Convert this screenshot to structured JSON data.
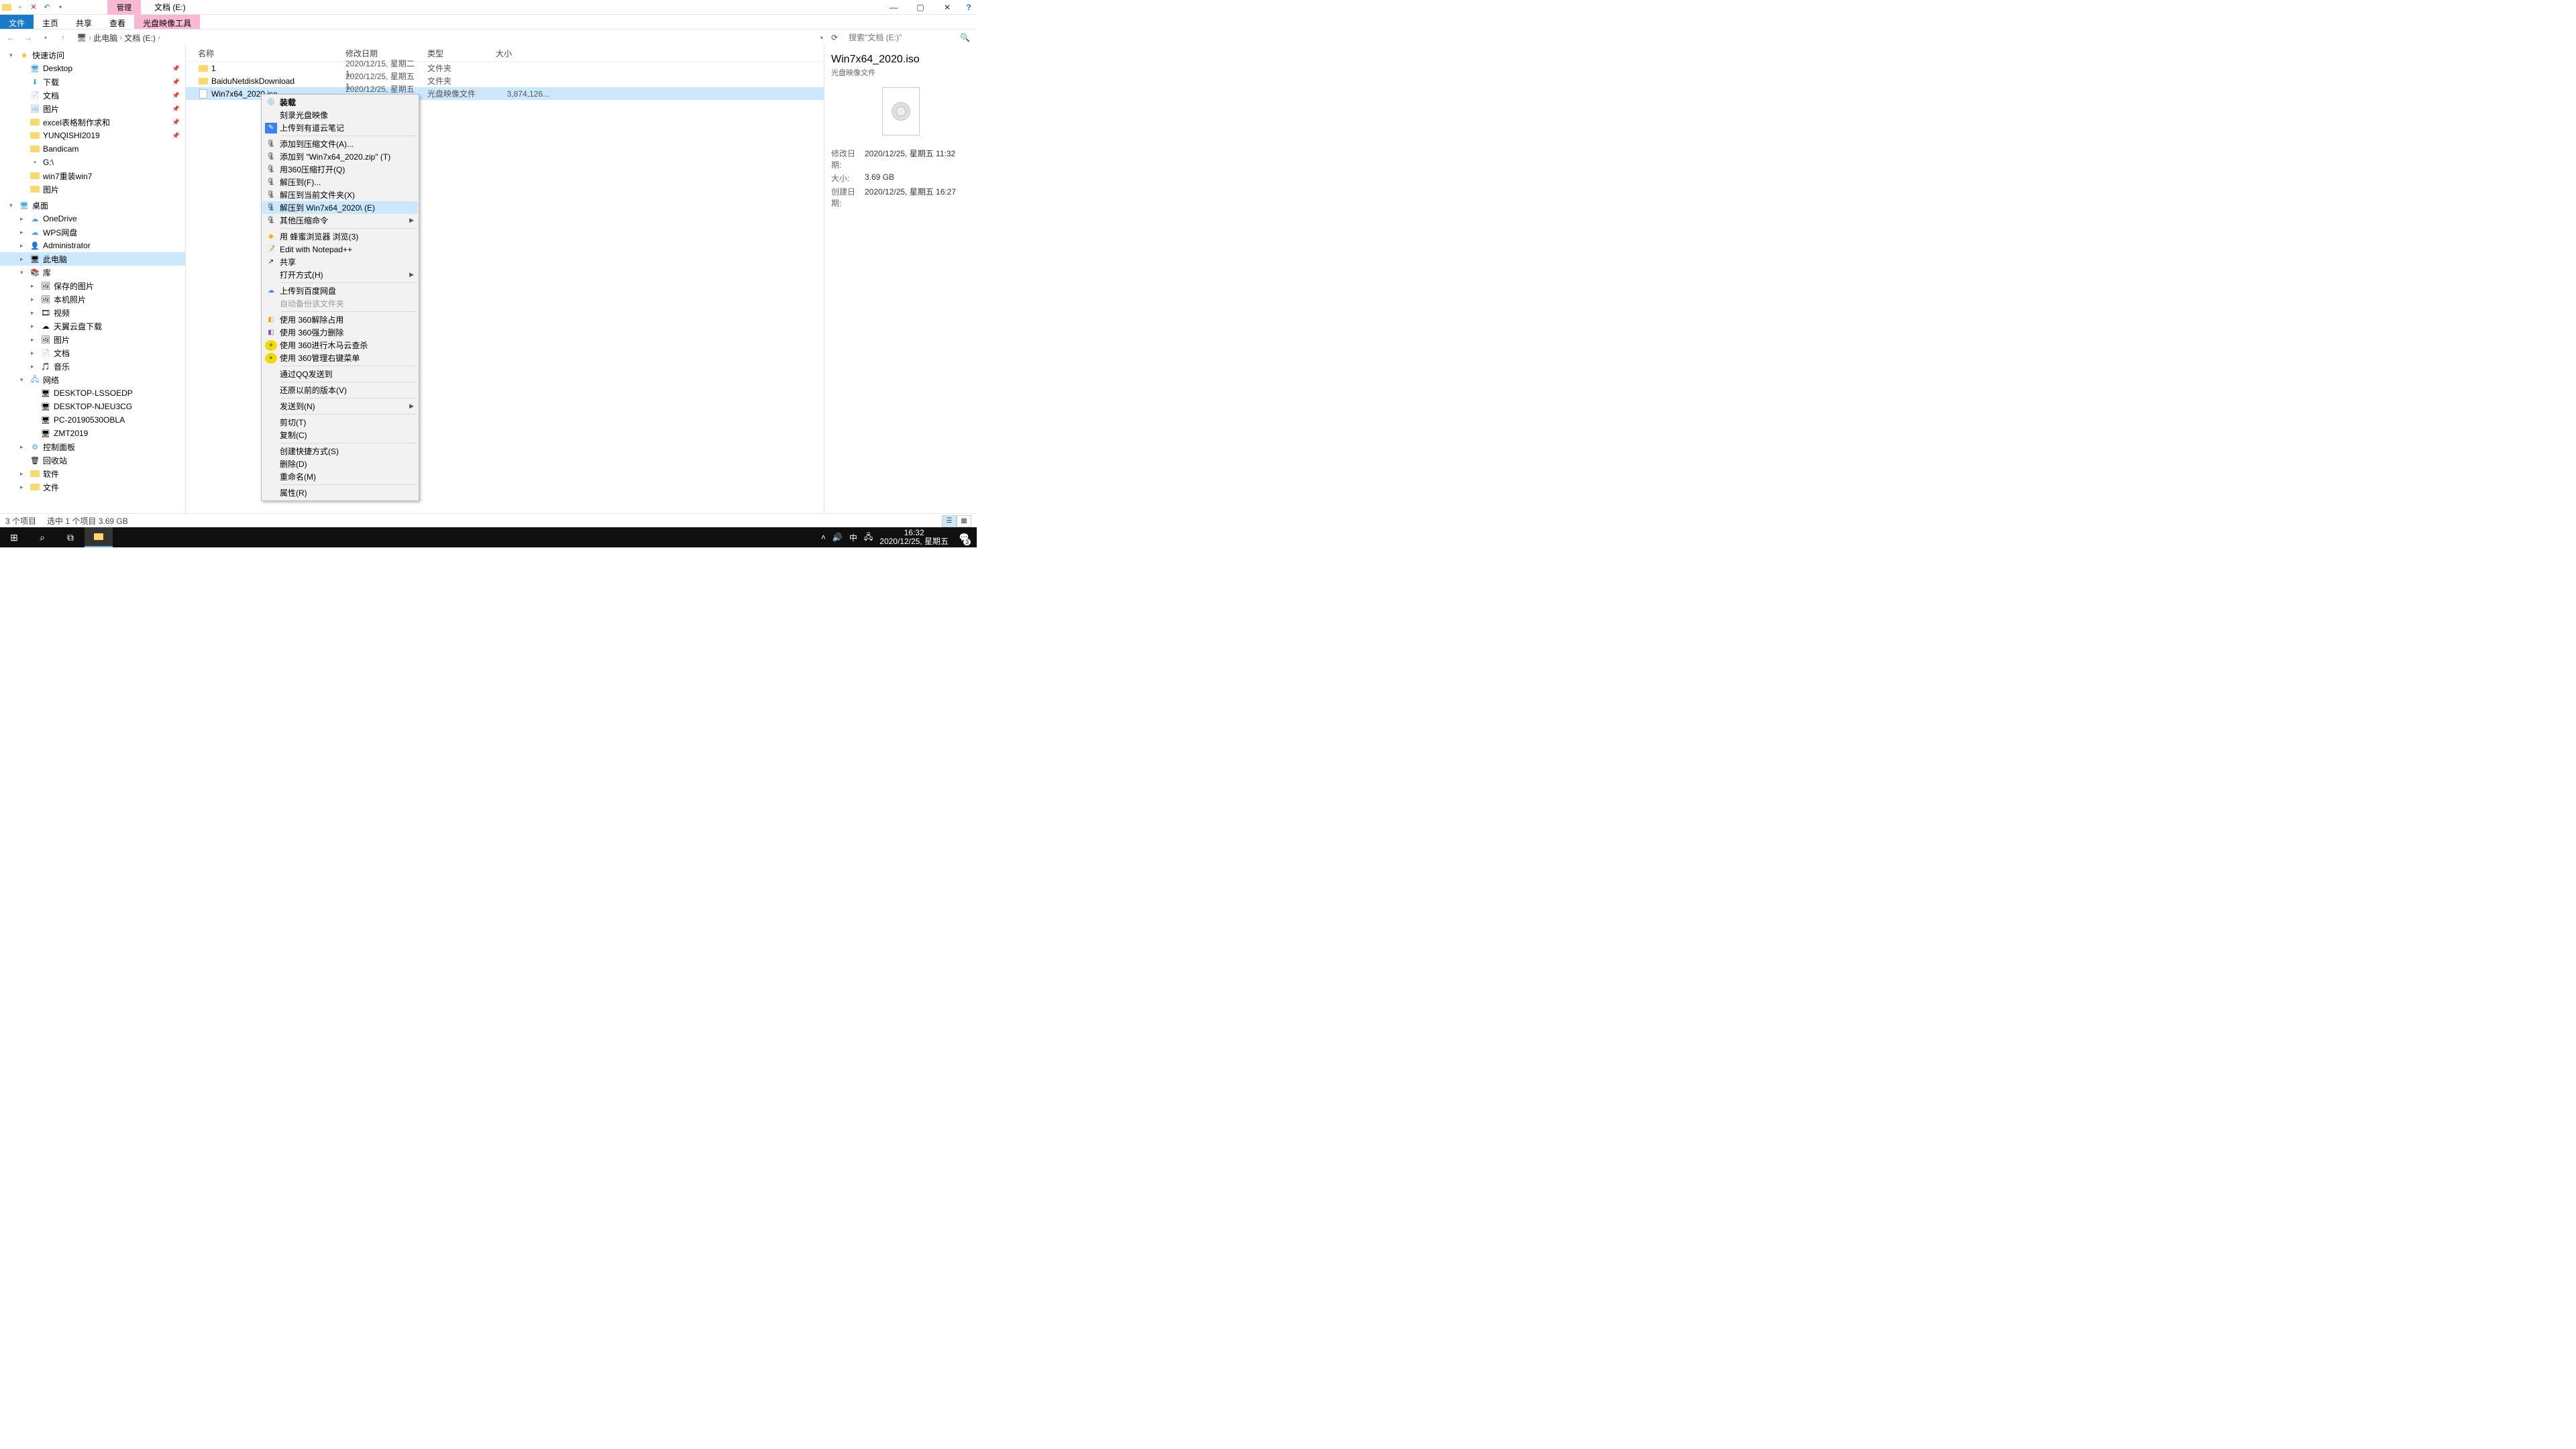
{
  "titlebar": {
    "mgmt_tab": "管理",
    "title": "文档 (E:)"
  },
  "ribbon": {
    "file": "文件",
    "home": "主页",
    "share": "共享",
    "view": "查看",
    "disc_tools": "光盘映像工具"
  },
  "breadcrumb": {
    "pc": "此电脑",
    "path": "文档 (E:)"
  },
  "search": {
    "placeholder": "搜索\"文档 (E:)\""
  },
  "tree": {
    "quick": "快速访问",
    "desktop": "Desktop",
    "downloads": "下载",
    "documents": "文档",
    "pictures": "图片",
    "excel": "excel表格制作求和",
    "yunqishi": "YUNQISHI2019",
    "bandicam": "Bandicam",
    "gdrive": "G:\\",
    "win7": "win7重装win7",
    "pics2": "图片",
    "desktop_cn": "桌面",
    "onedrive": "OneDrive",
    "wps": "WPS网盘",
    "admin": "Administrator",
    "thispc": "此电脑",
    "library": "库",
    "saved_pics": "保存的图片",
    "local_pics": "本机照片",
    "videos": "视频",
    "tianyi": "天翼云盘下载",
    "lib_pics": "图片",
    "lib_docs": "文档",
    "lib_music": "音乐",
    "network": "网络",
    "pc1": "DESKTOP-LSSOEDP",
    "pc2": "DESKTOP-NJEU3CG",
    "pc3": "PC-20190530OBLA",
    "pc4": "ZMT2019",
    "ctrlpanel": "控制面板",
    "recycle": "回收站",
    "software": "软件",
    "files": "文件"
  },
  "columns": {
    "name": "名称",
    "date": "修改日期",
    "type": "类型",
    "size": "大小"
  },
  "rows": [
    {
      "name": "1",
      "date": "2020/12/15, 星期二 1...",
      "type": "文件夹",
      "size": ""
    },
    {
      "name": "BaiduNetdiskDownload",
      "date": "2020/12/25, 星期五 1...",
      "type": "文件夹",
      "size": ""
    },
    {
      "name": "Win7x64_2020.iso",
      "date": "2020/12/25, 星期五 1...",
      "type": "光盘映像文件",
      "size": "3,874,126..."
    }
  ],
  "ctx": {
    "mount": "装载",
    "burn": "刻录光盘映像",
    "youdao": "上传到有道云笔记",
    "add_zip": "添加到压缩文件(A)...",
    "add_zip_named": "添加到 \"Win7x64_2020.zip\" (T)",
    "open_360zip": "用360压缩打开(Q)",
    "extract_to": "解压到(F)...",
    "extract_here": "解压到当前文件夹(X)",
    "extract_named": "解压到 Win7x64_2020\\ (E)",
    "other_zip": "其他压缩命令",
    "honey": "用 蜂蜜浏览器 浏览(3)",
    "notepad": "Edit with Notepad++",
    "share": "共享",
    "open_with": "打开方式(H)",
    "baidu_up": "上传到百度网盘",
    "auto_bak": "自动备份该文件夹",
    "u360_1": "使用 360解除占用",
    "u360_2": "使用 360强力删除",
    "u360_3": "使用 360进行木马云查杀",
    "u360_4": "使用 360管理右键菜单",
    "qq_send": "通过QQ发送到",
    "restore": "还原以前的版本(V)",
    "send_to": "发送到(N)",
    "cut": "剪切(T)",
    "copy": "复制(C)",
    "shortcut": "创建快捷方式(S)",
    "delete": "删除(D)",
    "rename": "重命名(M)",
    "props": "属性(R)"
  },
  "details": {
    "title": "Win7x64_2020.iso",
    "sub": "光盘映像文件",
    "mod_label": "修改日期:",
    "mod_val": "2020/12/25, 星期五 11:32",
    "size_label": "大小:",
    "size_val": "3.69 GB",
    "create_label": "创建日期:",
    "create_val": "2020/12/25, 星期五 16:27"
  },
  "status": {
    "count": "3 个项目",
    "sel": "选中 1 个项目  3.69 GB"
  },
  "taskbar": {
    "ime": "中",
    "time": "16:32",
    "date": "2020/12/25, 星期五",
    "notif": "3"
  }
}
